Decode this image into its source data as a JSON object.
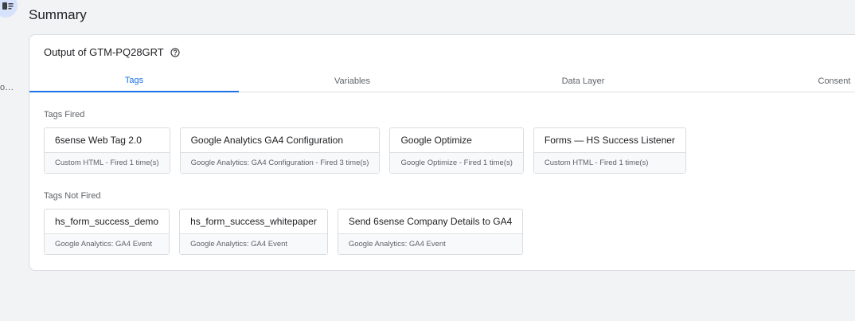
{
  "page": {
    "title": "Summary"
  },
  "rail": {
    "more_label": "o..."
  },
  "output": {
    "title": "Output of GTM-PQ28GRT"
  },
  "tabs": [
    {
      "label": "Tags"
    },
    {
      "label": "Variables"
    },
    {
      "label": "Data Layer"
    },
    {
      "label": "Consent"
    }
  ],
  "tags_fired": {
    "title": "Tags Fired",
    "items": [
      {
        "name": "6sense Web Tag 2.0",
        "meta": "Custom HTML - Fired 1 time(s)"
      },
      {
        "name": "Google Analytics GA4 Configuration",
        "meta": "Google Analytics: GA4 Configuration - Fired 3 time(s)"
      },
      {
        "name": "Google Optimize",
        "meta": "Google Optimize - Fired 1 time(s)"
      },
      {
        "name": "Forms — HS Success Listener",
        "meta": "Custom HTML - Fired 1 time(s)"
      }
    ]
  },
  "tags_not_fired": {
    "title": "Tags Not Fired",
    "items": [
      {
        "name": "hs_form_success_demo",
        "meta": "Google Analytics: GA4 Event"
      },
      {
        "name": "hs_form_success_whitepaper",
        "meta": "Google Analytics: GA4 Event"
      },
      {
        "name": "Send 6sense Company Details to GA4",
        "meta": "Google Analytics: GA4 Event"
      }
    ]
  }
}
